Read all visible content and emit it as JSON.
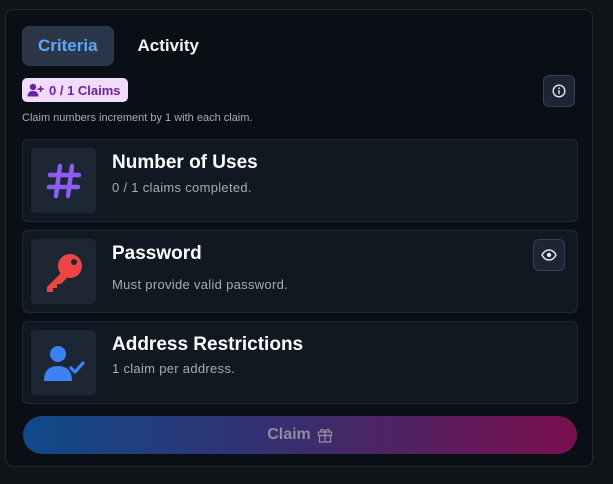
{
  "tabs": [
    {
      "label": "Criteria",
      "active": true
    },
    {
      "label": "Activity",
      "active": false
    }
  ],
  "claims_badge": "0 / 1 Claims",
  "subnote": "Claim numbers increment by 1 with each claim.",
  "criteria": [
    {
      "title": "Number of Uses",
      "description": "0 / 1 claims completed.",
      "icon": "hashtag-icon"
    },
    {
      "title": "Password",
      "description": "Must provide valid password.",
      "icon": "key-icon"
    },
    {
      "title": "Address Restrictions",
      "description": "1 claim per address.",
      "icon": "user-check-icon"
    }
  ],
  "claim_button": {
    "label": "Claim",
    "icon": "gift-icon"
  },
  "colors": {
    "accent_blue": "#60a5fa",
    "badge_bg": "#f1ddfb",
    "badge_text": "#6b21a8",
    "hashtag": "#8b5cf6",
    "key": "#ef4444",
    "user": "#3b82f6"
  }
}
